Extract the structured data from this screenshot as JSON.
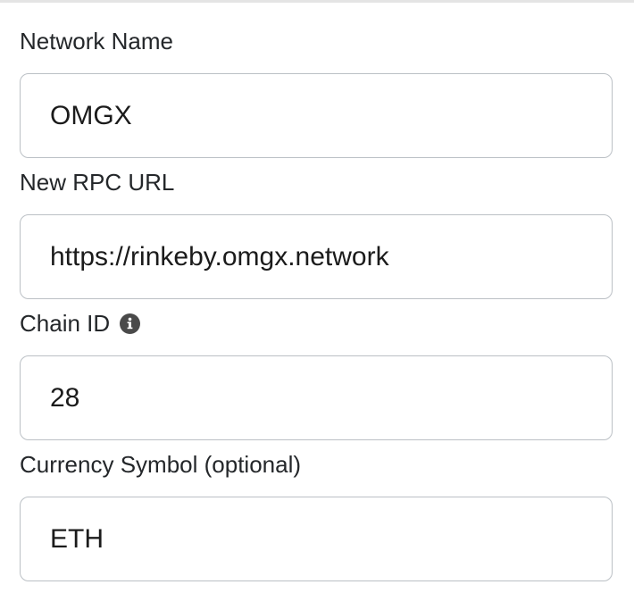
{
  "form": {
    "fields": [
      {
        "label": "Network Name",
        "value": "OMGX",
        "has_info_icon": false
      },
      {
        "label": "New RPC URL",
        "value": "https://rinkeby.omgx.network",
        "has_info_icon": false
      },
      {
        "label": "Chain ID",
        "value": "28",
        "has_info_icon": true,
        "info_icon": "info-circle-icon"
      },
      {
        "label": "Currency Symbol (optional)",
        "value": "ETH",
        "has_info_icon": false
      }
    ]
  },
  "colors": {
    "text": "#24272a",
    "input_border": "#bbc0c5",
    "divider": "#e4e4e4",
    "icon": "#4a4a4a"
  }
}
